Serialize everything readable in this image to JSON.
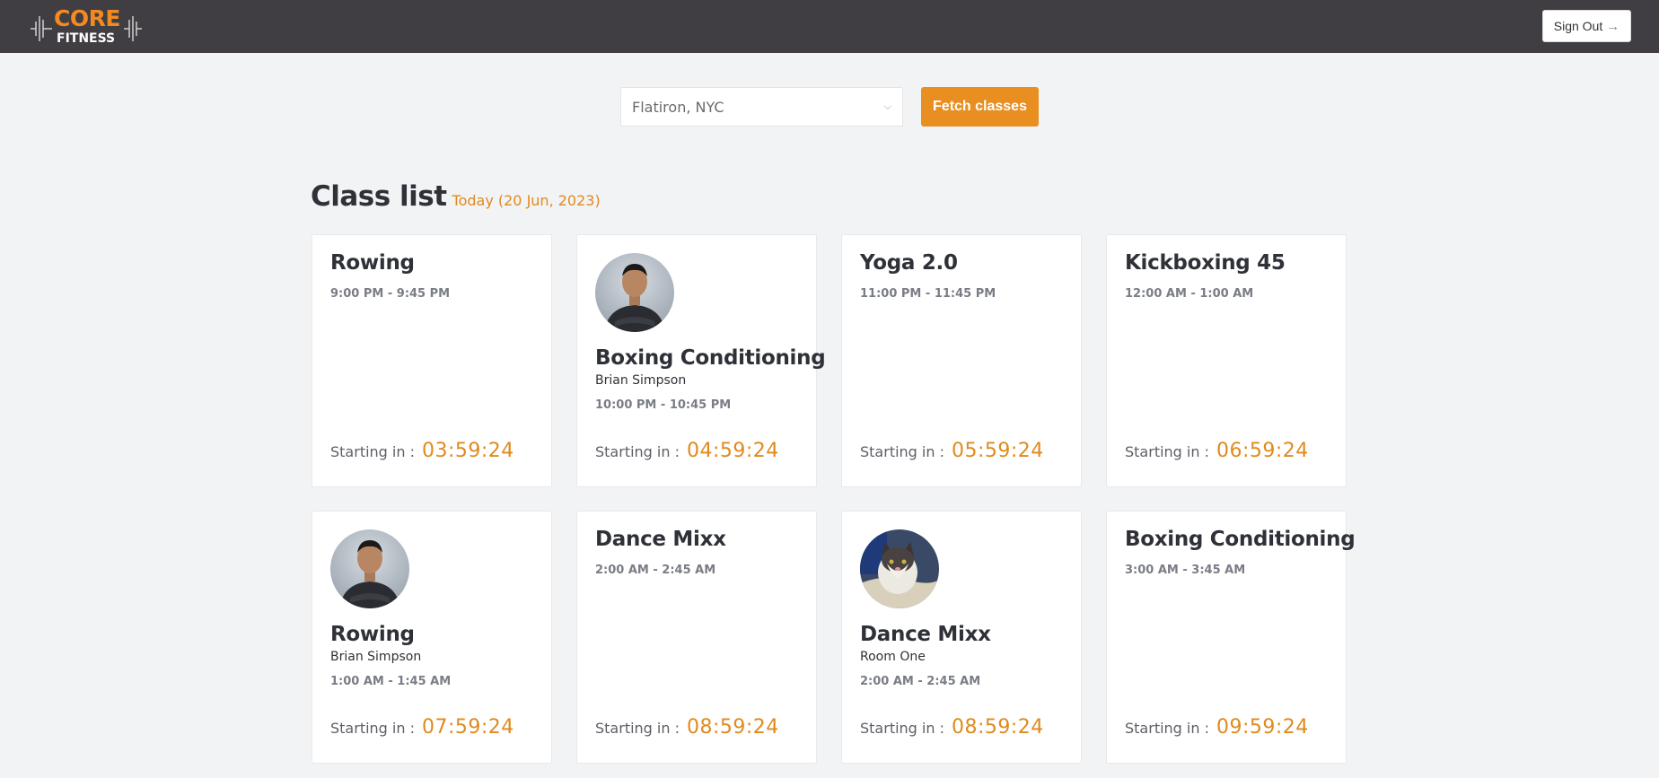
{
  "header": {
    "logo_top": "CORE",
    "logo_bottom": "FITNESS",
    "signout_label": "Sign Out",
    "signout_icon": "arrow-right-icon"
  },
  "filter": {
    "location_value": "Flatiron, NYC",
    "fetch_label": "Fetch classes"
  },
  "heading": {
    "title": "Class list",
    "date": "Today (20 Jun, 2023)"
  },
  "starting_label": "Starting in :",
  "accent_color": "#e98f22",
  "classes": [
    {
      "name": "Rowing",
      "instructor": "",
      "time": "9:00 PM - 9:45 PM",
      "countdown": "03:59:24",
      "avatar": ""
    },
    {
      "name": "Boxing Conditioning",
      "instructor": "Brian Simpson",
      "time": "10:00 PM - 10:45 PM",
      "countdown": "04:59:24",
      "avatar": "man-photo"
    },
    {
      "name": "Yoga 2.0",
      "instructor": "",
      "time": "11:00 PM - 11:45 PM",
      "countdown": "05:59:24",
      "avatar": ""
    },
    {
      "name": "Kickboxing 45",
      "instructor": "",
      "time": "12:00 AM - 1:00 AM",
      "countdown": "06:59:24",
      "avatar": ""
    },
    {
      "name": "Rowing",
      "instructor": "Brian Simpson",
      "time": "1:00 AM - 1:45 AM",
      "countdown": "07:59:24",
      "avatar": "man-photo"
    },
    {
      "name": "Dance Mixx",
      "instructor": "",
      "time": "2:00 AM - 2:45 AM",
      "countdown": "08:59:24",
      "avatar": ""
    },
    {
      "name": "Dance Mixx",
      "instructor": "Room One",
      "time": "2:00 AM - 2:45 AM",
      "countdown": "08:59:24",
      "avatar": "cat-photo"
    },
    {
      "name": "Boxing Conditioning",
      "instructor": "",
      "time": "3:00 AM - 3:45 AM",
      "countdown": "09:59:24",
      "avatar": ""
    }
  ]
}
